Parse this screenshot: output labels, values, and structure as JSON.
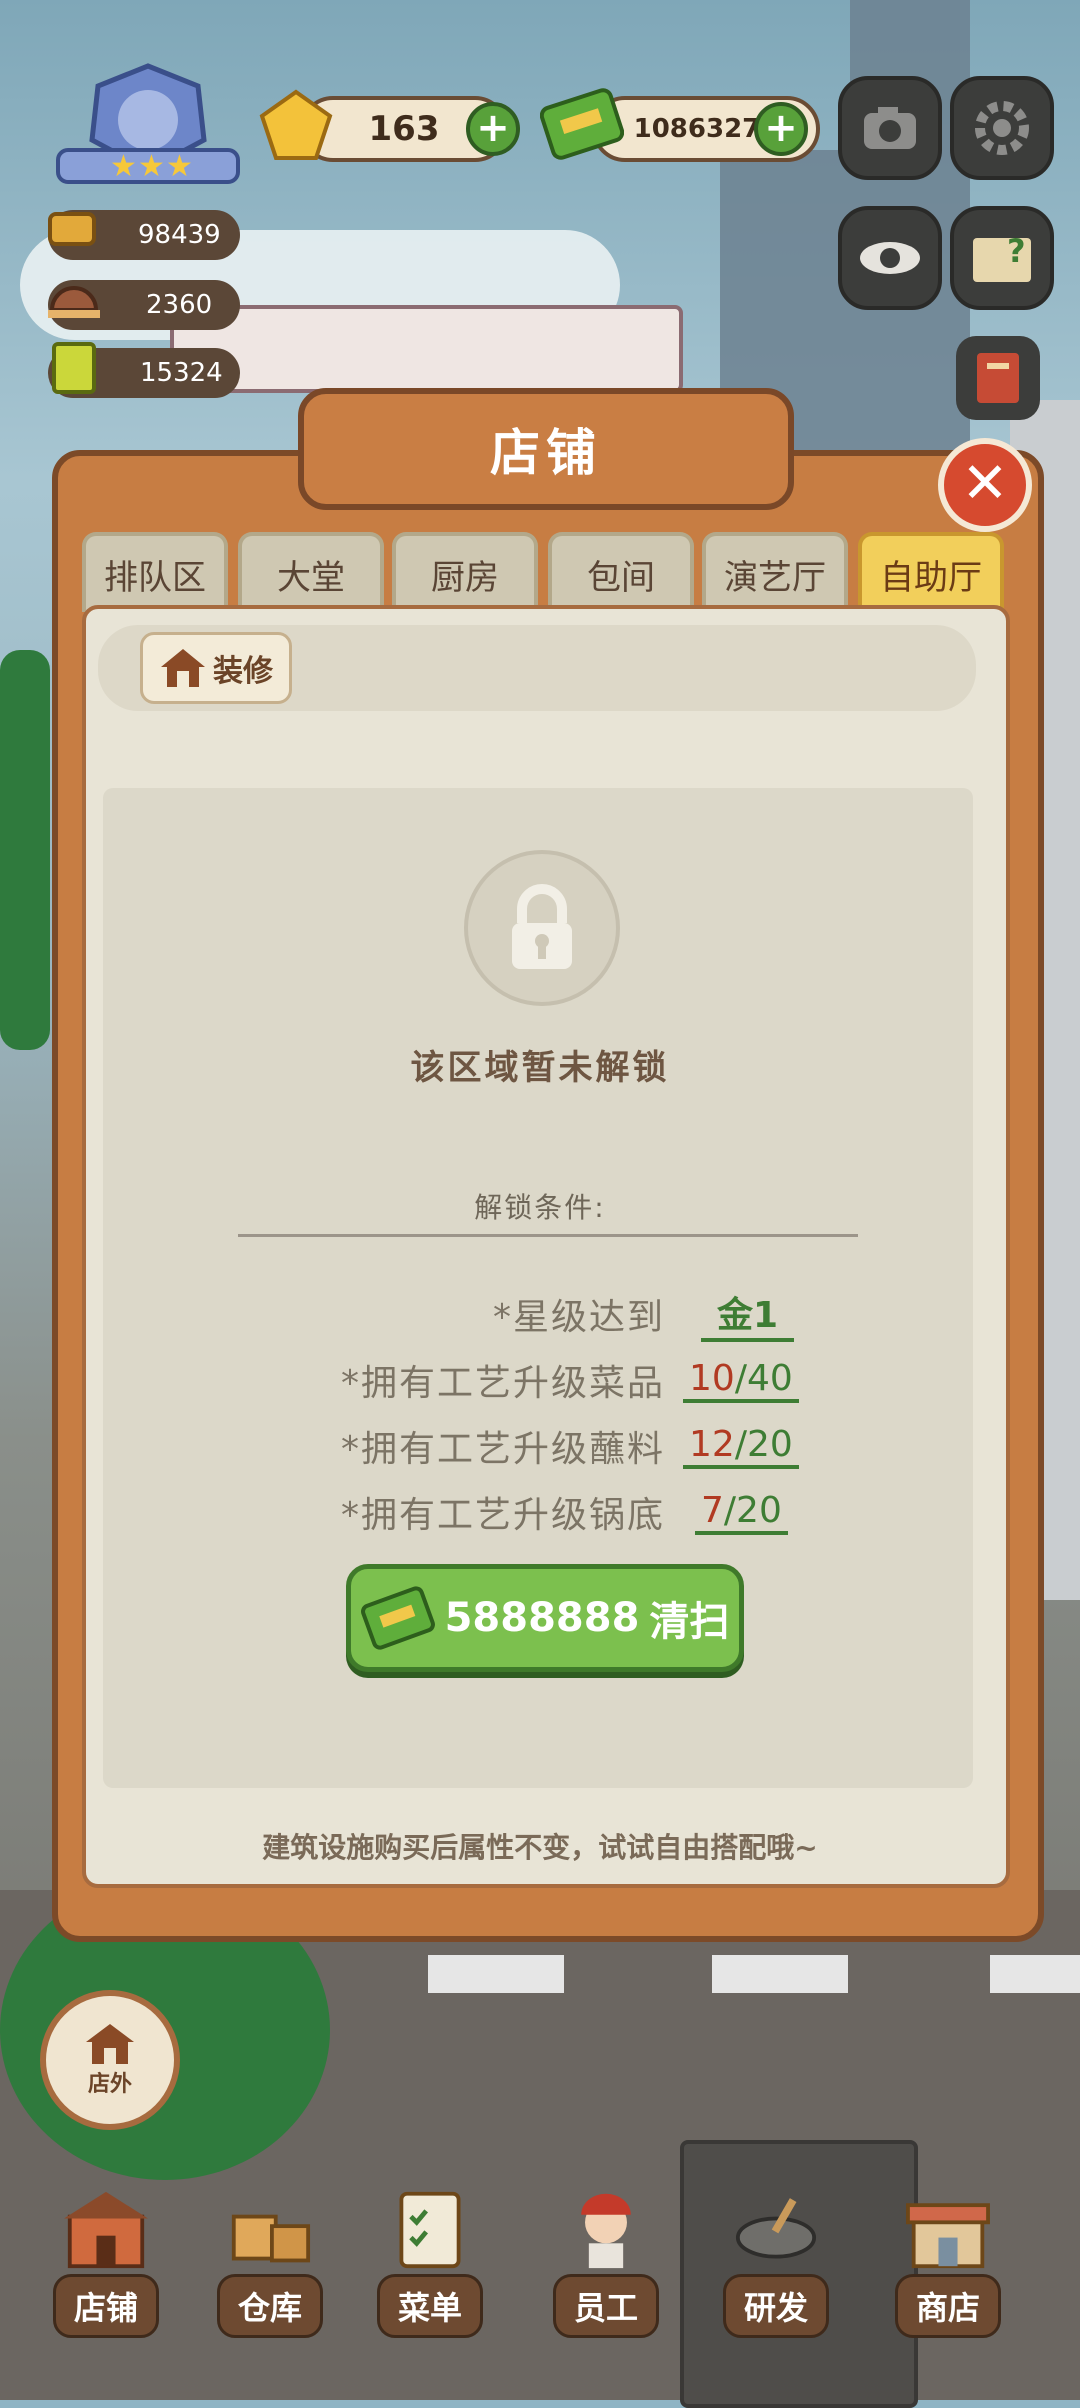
{
  "hud": {
    "gem_count": "163",
    "cash_count": "10863277",
    "stat_coin": "98439",
    "stat_serving": "2360",
    "stat_menu": "15324",
    "stars": 3
  },
  "panel": {
    "title": "店铺",
    "close": "✕",
    "tabs": [
      "排队区",
      "大堂",
      "厨房",
      "包间",
      "演艺厅",
      "自助厅"
    ],
    "active_tab": 5,
    "decorate_label": "装修",
    "locked_text": "该区域暂未解锁",
    "unlock_title": "解锁条件:",
    "requirements": [
      {
        "label": "*星级达到",
        "value": "金1",
        "have": "",
        "need": ""
      },
      {
        "label": "*拥有工艺升级菜品",
        "value": "",
        "have": "10",
        "need": "/40"
      },
      {
        "label": "*拥有工艺升级蘸料",
        "value": "",
        "have": "12",
        "need": "/20"
      },
      {
        "label": "*拥有工艺升级锅底",
        "value": "",
        "have": "7",
        "need": "/20"
      }
    ],
    "clean_cost": "5888888",
    "clean_label": "清扫",
    "footer_tip": "建筑设施购买后属性不变，试试自由搭配哦~"
  },
  "outside_label": "店外",
  "nav": [
    "店铺",
    "仓库",
    "菜单",
    "员工",
    "研发",
    "商店"
  ],
  "colors": {
    "accent_green": "#58a13a",
    "warn_red": "#b13a22",
    "wood": "#c77d43"
  }
}
